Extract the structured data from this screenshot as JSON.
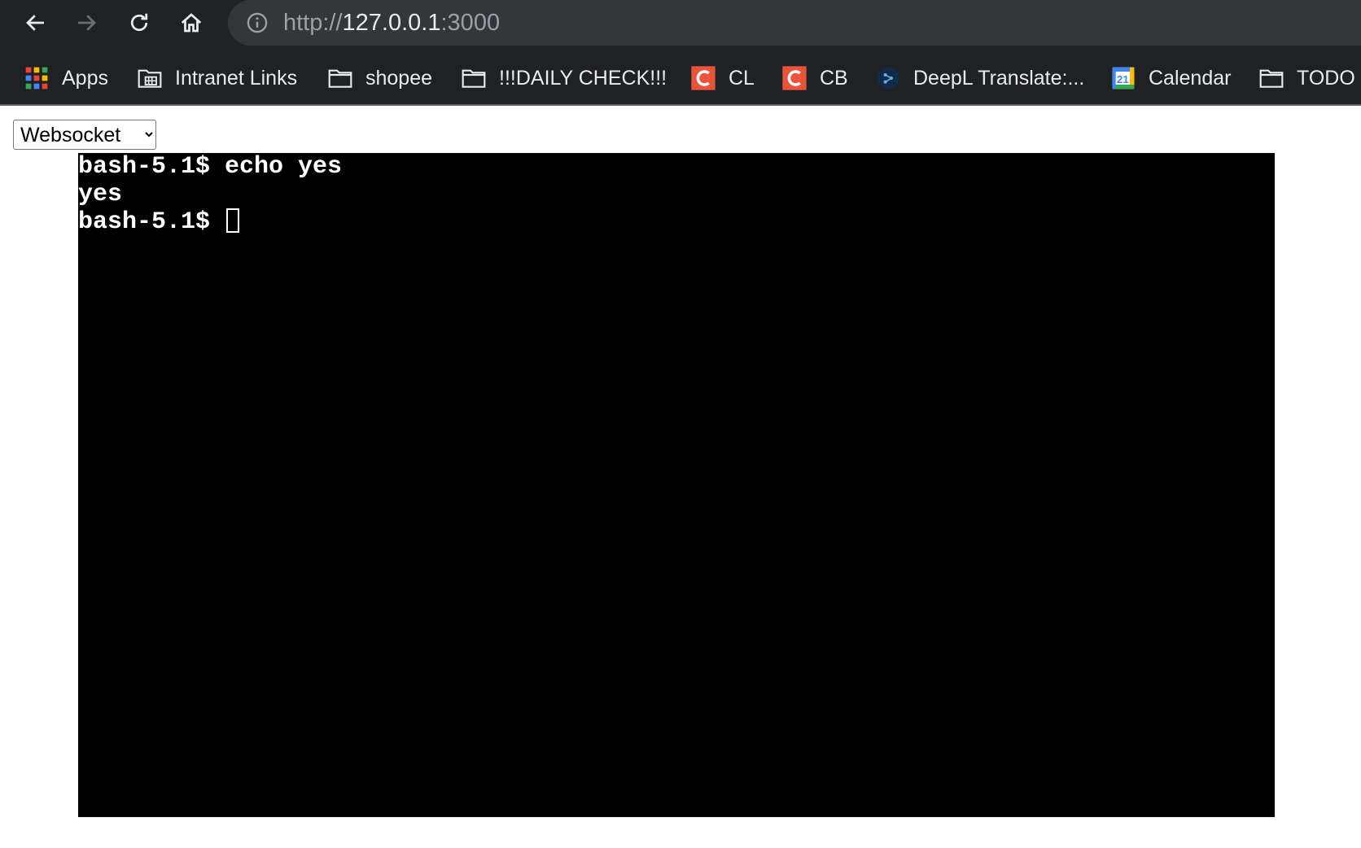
{
  "browser": {
    "url": {
      "scheme": "http://",
      "host": "127.0.0.1",
      "port": ":3000"
    },
    "bookmarks": [
      {
        "label": "Apps",
        "icon": "apps-grid-icon"
      },
      {
        "label": "Intranet Links",
        "icon": "building-folder-icon"
      },
      {
        "label": "shopee",
        "icon": "folder-icon"
      },
      {
        "label": "!!!DAILY CHECK!!!",
        "icon": "folder-icon"
      },
      {
        "label": "CL",
        "icon": "c-logo-icon"
      },
      {
        "label": "CB",
        "icon": "c-logo-icon"
      },
      {
        "label": "DeepL Translate:...",
        "icon": "deepl-icon"
      },
      {
        "label": "Calendar",
        "icon": "calendar-icon"
      },
      {
        "label": "TODO",
        "icon": "folder-icon"
      }
    ]
  },
  "page": {
    "mode_select": {
      "selected": "Websocket"
    },
    "terminal": {
      "lines": [
        "bash-5.1$ echo yes",
        "yes",
        "bash-5.1$ "
      ]
    }
  },
  "colors": {
    "chrome_bg": "#202124",
    "omnibox_bg": "#35363a",
    "terminal_bg": "#000000",
    "terminal_fg": "#ffffff",
    "bookmark_c_accent": "#e8553b",
    "deepl_accent": "#0f2b46"
  }
}
